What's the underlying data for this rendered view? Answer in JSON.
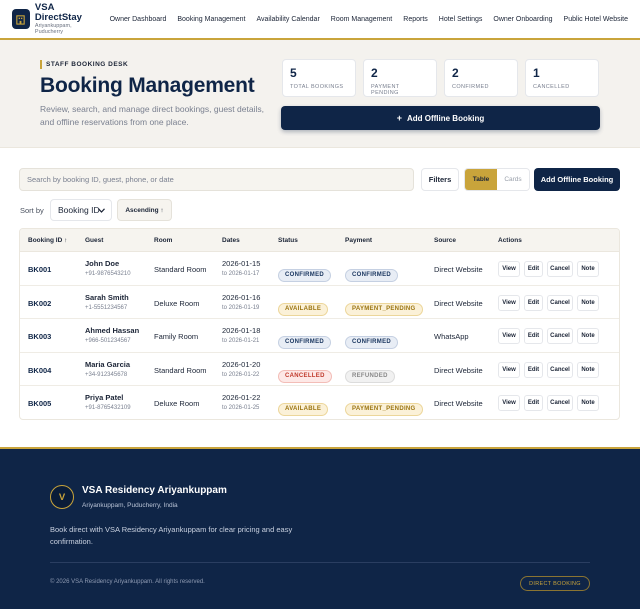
{
  "brand": {
    "name": "VSA DirectStay",
    "subtitle": "Ariyankuppam, Puducherry"
  },
  "nav": [
    "Owner Dashboard",
    "Booking Management",
    "Availability Calendar",
    "Room Management",
    "Reports",
    "Hotel Settings",
    "Owner Onboarding",
    "Public Hotel Website"
  ],
  "hero": {
    "eyebrow": "STAFF BOOKING DESK",
    "title": "Booking Management",
    "description": "Review, search, and manage direct bookings, guest details, and offline reservations from one place.",
    "add_button": "Add Offline Booking"
  },
  "stats": [
    {
      "value": "5",
      "label": "TOTAL BOOKINGS"
    },
    {
      "value": "2",
      "label": "PAYMENT PENDING"
    },
    {
      "value": "2",
      "label": "CONFIRMED"
    },
    {
      "value": "1",
      "label": "CANCELLED"
    }
  ],
  "toolbar": {
    "search_placeholder": "Search by booking ID, guest, phone, or date",
    "filters_label": "Filters",
    "view_table": "Table",
    "view_cards": "Cards",
    "add_button": "Add Offline Booking",
    "sort_label": "Sort by",
    "sort_value": "Booking ID",
    "order_label": "Ascending ↑"
  },
  "table": {
    "headers": [
      "Booking ID ↑",
      "Guest",
      "Room",
      "Dates",
      "Status",
      "Payment",
      "Source",
      "Actions"
    ],
    "rows": [
      {
        "id": "BK001",
        "guest": "John Doe",
        "phone": "+91-9876543210",
        "room": "Standard Room",
        "start": "2026-01-15",
        "end": "to 2026-01-17",
        "status": "CONFIRMED",
        "payment": "CONFIRMED",
        "source": "Direct Website"
      },
      {
        "id": "BK002",
        "guest": "Sarah Smith",
        "phone": "+1-5551234567",
        "room": "Deluxe Room",
        "start": "2026-01-16",
        "end": "to 2026-01-19",
        "status": "AVAILABLE",
        "payment": "PAYMENT_PENDING",
        "source": "Direct Website"
      },
      {
        "id": "BK003",
        "guest": "Ahmed Hassan",
        "phone": "+966-501234567",
        "room": "Family Room",
        "start": "2026-01-18",
        "end": "to 2026-01-21",
        "status": "CONFIRMED",
        "payment": "CONFIRMED",
        "source": "WhatsApp"
      },
      {
        "id": "BK004",
        "guest": "Maria Garcia",
        "phone": "+34-912345678",
        "room": "Standard Room",
        "start": "2026-01-20",
        "end": "to 2026-01-22",
        "status": "CANCELLED",
        "payment": "REFUNDED",
        "source": "Direct Website"
      },
      {
        "id": "BK005",
        "guest": "Priya Patel",
        "phone": "+91-8765432109",
        "room": "Deluxe Room",
        "start": "2026-01-22",
        "end": "to 2026-01-25",
        "status": "AVAILABLE",
        "payment": "PAYMENT_PENDING",
        "source": "Direct Website"
      }
    ],
    "actions": {
      "view": "View",
      "edit": "Edit",
      "cancel": "Cancel",
      "note": "Note"
    }
  },
  "footer": {
    "logo_letter": "V",
    "name": "VSA Residency Ariyankuppam",
    "location": "Ariyankuppam, Puducherry, India",
    "description": "Book direct with VSA Residency Ariyankuppam for clear pricing and easy confirmation.",
    "copyright": "© 2026 VSA Residency Ariyankuppam. All rights reserved.",
    "badge": "DIRECT BOOKING"
  },
  "colors": {
    "navy": "#0f2547",
    "gold": "#c9a43b",
    "cancelled_red": "#c0392b"
  }
}
